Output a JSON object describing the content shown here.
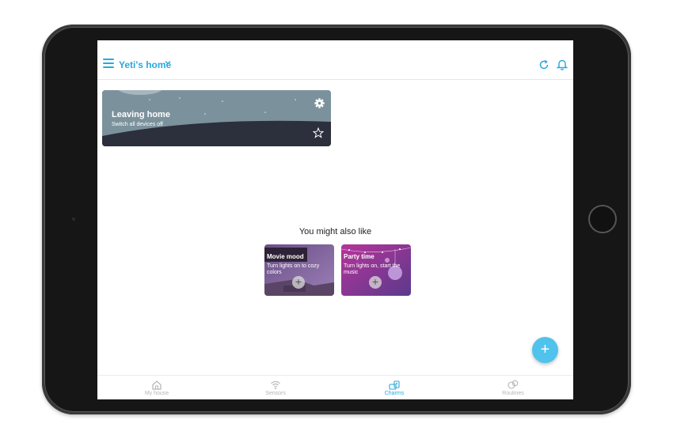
{
  "header": {
    "home_name": "Yeti's home",
    "chevron_icon": "chevron-down-icon",
    "accent_color": "#29a8de"
  },
  "scene": {
    "title": "Leaving home",
    "subtitle": "Switch all devices off",
    "icons": [
      "gear-icon",
      "star-icon"
    ]
  },
  "suggestions": {
    "heading": "You might also like",
    "items": [
      {
        "title": "Movie mood",
        "description": "Turn lights on to cozy colors",
        "add_label": "+"
      },
      {
        "title": "Party time",
        "description": "Turn lights on, start the music",
        "add_label": "+"
      }
    ]
  },
  "fab": {
    "label": "+"
  },
  "nav": {
    "items": [
      {
        "label": "My house",
        "icon": "house-icon"
      },
      {
        "label": "Sensors",
        "icon": "sensor-icon"
      },
      {
        "label": "Charms",
        "icon": "charms-icon",
        "active": true
      },
      {
        "label": "Routines",
        "icon": "routines-icon"
      }
    ]
  }
}
